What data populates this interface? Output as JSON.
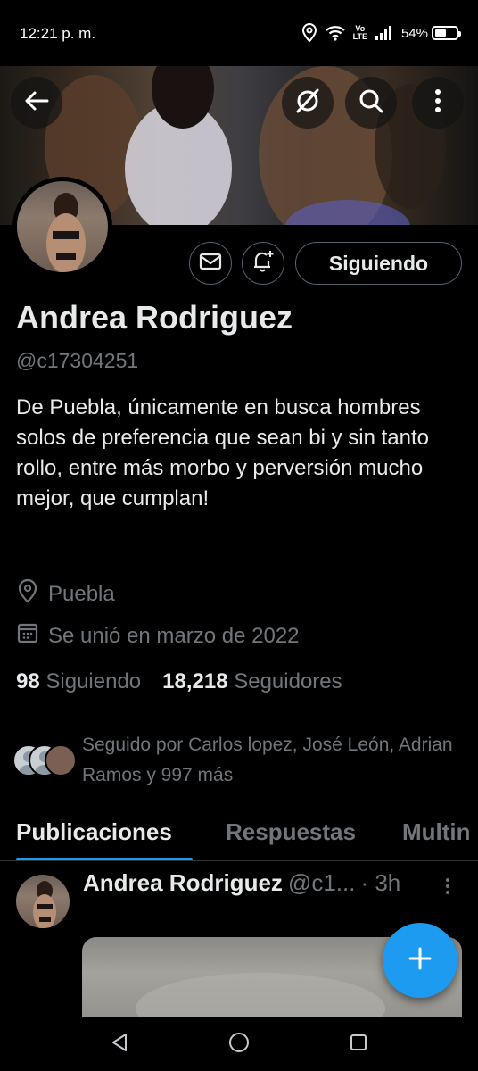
{
  "status_bar": {
    "time": "12:21 p. m.",
    "network_label_top": "Vo",
    "network_label_bottom": "LTE",
    "battery_level": "54%",
    "battery_fraction": 0.54,
    "icons": [
      "location-icon",
      "wifi-icon",
      "volte-icon",
      "signal-icon",
      "battery-icon"
    ]
  },
  "header": {
    "back_icon": "back-arrow-icon",
    "grok_icon": "grok-icon",
    "search_icon": "search-icon",
    "more_icon": "more-vertical-icon"
  },
  "profile": {
    "name": "Andrea Rodriguez",
    "handle": "@c17304251",
    "bio": "De Puebla, únicamente en busca hombres solos de preferencia que sean bi y sin tanto rollo, entre más morbo y perversión mucho mejor, que cumplan!",
    "location": "Puebla",
    "joined": "Se unió en marzo de 2022",
    "following_count": "98",
    "following_label": "Siguiendo",
    "followers_count": "18,218",
    "followers_label": "Seguidores",
    "followed_by": "Seguido por Carlos lopez, José León, Adrian Ramos y 997 más"
  },
  "actions": {
    "message_icon": "mail-icon",
    "notify_icon": "bell-plus-icon",
    "follow_label": "Siguiendo"
  },
  "tabs": [
    {
      "label": "Publicaciones",
      "active": true
    },
    {
      "label": "Respuestas",
      "active": false
    },
    {
      "label": "Multin",
      "active": false
    }
  ],
  "tweet": {
    "name": "Andrea Rodriguez",
    "handle": "@c1...",
    "time": "· 3h"
  },
  "fab": {
    "icon": "plus-icon"
  },
  "colors": {
    "accent": "#1d9bf0",
    "background": "#000000",
    "text_primary": "#e7e9ea",
    "text_secondary": "#71767b",
    "border": "#536471"
  },
  "nav": [
    "back-triangle-icon",
    "home-circle-icon",
    "recents-square-icon"
  ]
}
